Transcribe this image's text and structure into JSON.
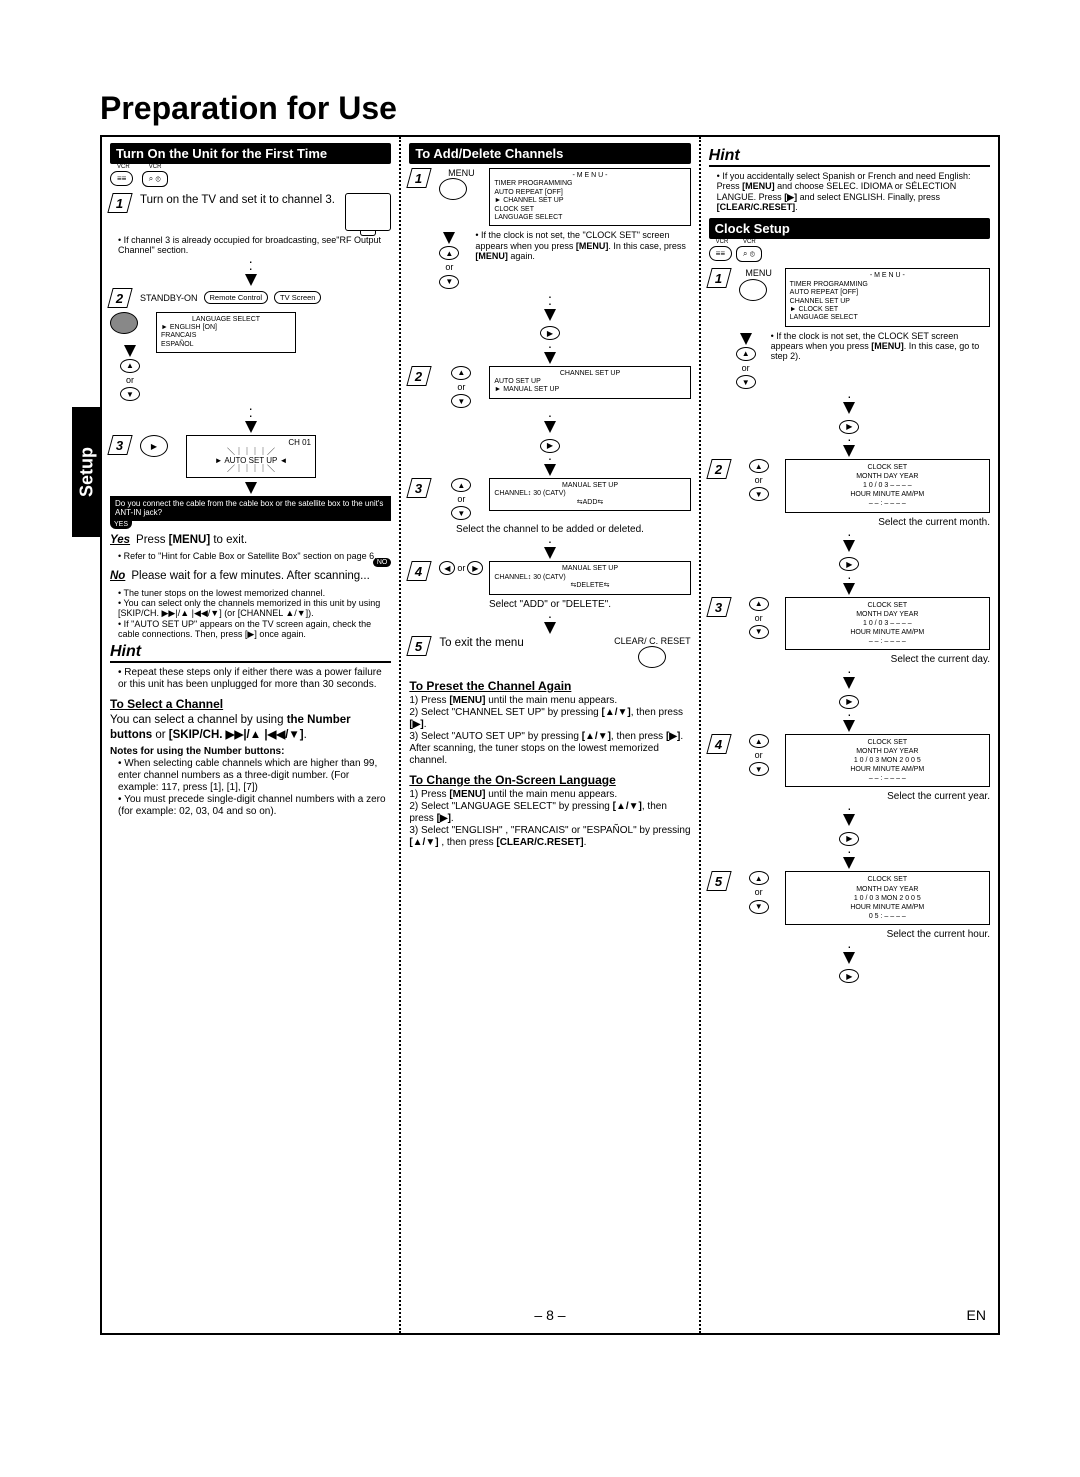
{
  "page": {
    "title": "Preparation for Use",
    "sideTab": "Setup",
    "pageNum": "– 8 –",
    "lang": "EN"
  },
  "col1": {
    "header": "Turn On the Unit for the First Time",
    "vcrLabel": "VCR",
    "step1": {
      "num": "1",
      "text": "Turn on the TV and set it to channel 3.",
      "note": "If channel 3 is already occupied for broadcasting, see\"RF Output Channel\" section."
    },
    "step2": {
      "num": "2",
      "standby": "STANDBY-ON",
      "rc": "Remote Control",
      "tvs": "TV Screen",
      "langBox": {
        "title": "LANGUAGE SELECT",
        "items": [
          "► ENGLISH       [ON]",
          "   FRANCAIS",
          "   ESPAÑOL"
        ]
      },
      "or": "or"
    },
    "step3": {
      "num": "3",
      "ch": "CH 01",
      "auto": "AUTO SET UP"
    },
    "blackBox": "Do you connect the cable from the cable box or the satellite box to the unit's ANT-IN jack?",
    "yesLine": {
      "yes": "Yes",
      "text": "Press MENU to exit.",
      "note": "Refer to \"Hint for Cable Box or Satellite Box\" section on page 6."
    },
    "noLine": {
      "no": "No",
      "text": "Please wait for a few minutes. After scanning..."
    },
    "bullets": [
      "The tuner stops on the lowest memorized channel.",
      "You can select only the channels memorized in this unit by using [SKIP/CH. ▶▶|/▲ |◀◀/▼] (or [CHANNEL ▲/▼]).",
      "If \"AUTO SET UP\" appears on the TV screen again, check the cable connections. Then, press [▶] once again."
    ],
    "hint": {
      "label": "Hint",
      "text": "Repeat these steps only if either there was a power failure or this unit has been unplugged for more than 30 seconds."
    },
    "selectCh": {
      "title": "To Select a Channel",
      "text": "You can select a channel by using the Number buttons or [SKIP/CH. ▶▶|/▲ |◀◀/▼].",
      "noteTitle": "Notes for using the Number buttons:",
      "notes": [
        "When selecting cable channels which are higher than 99, enter channel numbers as a three-digit number. (For example: 117, press [1], [1], [7])",
        "You must precede single-digit channel numbers with a zero (for example: 02, 03, 04 and so on)."
      ]
    }
  },
  "col2": {
    "header": "To Add/Delete Channels",
    "step1": {
      "num": "1",
      "menuLabel": "MENU",
      "menuBox": {
        "title": "- M E N U -",
        "items": [
          "TIMER PROGRAMMING",
          "AUTO REPEAT  [OFF]",
          "► CHANNEL SET UP",
          "CLOCK SET",
          "LANGUAGE SELECT"
        ]
      },
      "or": "or",
      "note": "If the clock is not set, the \"CLOCK SET\" screen appears when you press [MENU]. In this case, press [MENU] again."
    },
    "step2": {
      "num": "2",
      "box": {
        "title": "CHANNEL SET UP",
        "items": [
          "AUTO SET UP",
          "► MANUAL SET UP"
        ]
      },
      "or": "or"
    },
    "step3": {
      "num": "3",
      "box": {
        "title": "MANUAL SET UP",
        "line": "CHANNEL↕ 30    (CATV)",
        "action": "ADD"
      },
      "or": "or",
      "note": "Select the channel to be added or deleted."
    },
    "step4": {
      "num": "4",
      "box": {
        "title": "MANUAL SET UP",
        "line": "CHANNEL↕ 30    (CATV)",
        "action": "DELETE"
      },
      "or": "or",
      "note": "Select \"ADD\" or \"DELETE\"."
    },
    "step5": {
      "num": "5",
      "text": "To exit the menu",
      "btn": "CLEAR/ C. RESET"
    },
    "preset": {
      "title": "To Preset the Channel Again",
      "lines": [
        "1) Press [MENU] until the main menu appears.",
        "2) Select \"CHANNEL SET UP\" by pressing [▲/▼], then press [▶].",
        "3) Select \"AUTO SET UP\" by pressing [▲/▼], then press [▶]. After scanning, the tuner stops on the lowest memorized channel."
      ]
    },
    "langChange": {
      "title": "To Change the On-Screen Language",
      "lines": [
        "1) Press [MENU] until the main menu appears.",
        "2) Select \"LANGUAGE SELECT\" by pressing [▲/▼], then press [▶].",
        "3) Select \"ENGLISH\" , \"FRANCAIS\" or \"ESPAÑOL\" by pressing [▲/▼] , then press [CLEAR/C.RESET]."
      ]
    }
  },
  "col3": {
    "hintTop": {
      "label": "Hint",
      "text": "If you accidentally select Spanish or French and need English: Press [MENU] and choose SELEC. IDIOMA or SÉLECTION LANGUE. Press [▶] and select ENGLISH. Finally, press [CLEAR/C.RESET]."
    },
    "header": "Clock Setup",
    "step1": {
      "num": "1",
      "menuLabel": "MENU",
      "menuBox": {
        "title": "- M E N U -",
        "items": [
          "TIMER PROGRAMMING",
          "AUTO REPEAT  [OFF]",
          "CHANNEL SET UP",
          "► CLOCK SET",
          "LANGUAGE SELECT"
        ]
      },
      "or": "or",
      "note": "If the clock is not set, the CLOCK SET screen appears when you press [MENU]. In this case, go to step 2)."
    },
    "step2": {
      "num": "2",
      "title": "CLOCK SET",
      "l1": "MONTH  DAY        YEAR",
      "l2": "1 0  /  0 3        – – – –",
      "l3": "HOUR  MINUTE    AM/PM",
      "l4": "– –  :  – –            – –",
      "caption": "Select the current month.",
      "or": "or"
    },
    "step3": {
      "num": "3",
      "title": "CLOCK SET",
      "l1": "MONTH  DAY        YEAR",
      "l2": " 1 0   /  0 3         – – – –",
      "l3": "HOUR  MINUTE    AM/PM",
      "l4": "– –  :  – –            – –",
      "caption": "Select the current day.",
      "or": "or"
    },
    "step4": {
      "num": "4",
      "title": "CLOCK SET",
      "l1": "MONTH  DAY        YEAR",
      "l2": " 1 0   /   0 3   MON  2 0 0 5",
      "l3": "HOUR  MINUTE    AM/PM",
      "l4": "– –  :  – –            – –",
      "caption": "Select the current year.",
      "or": "or"
    },
    "step5": {
      "num": "5",
      "title": "CLOCK SET",
      "l1": "MONTH  DAY        YEAR",
      "l2": " 1 0   /   0 3   MON  2 0 0 5",
      "l3": "HOUR  MINUTE    AM/PM",
      "l4": " 0 5  :  – –            – –",
      "caption": "Select the current hour.",
      "or": "or"
    }
  }
}
